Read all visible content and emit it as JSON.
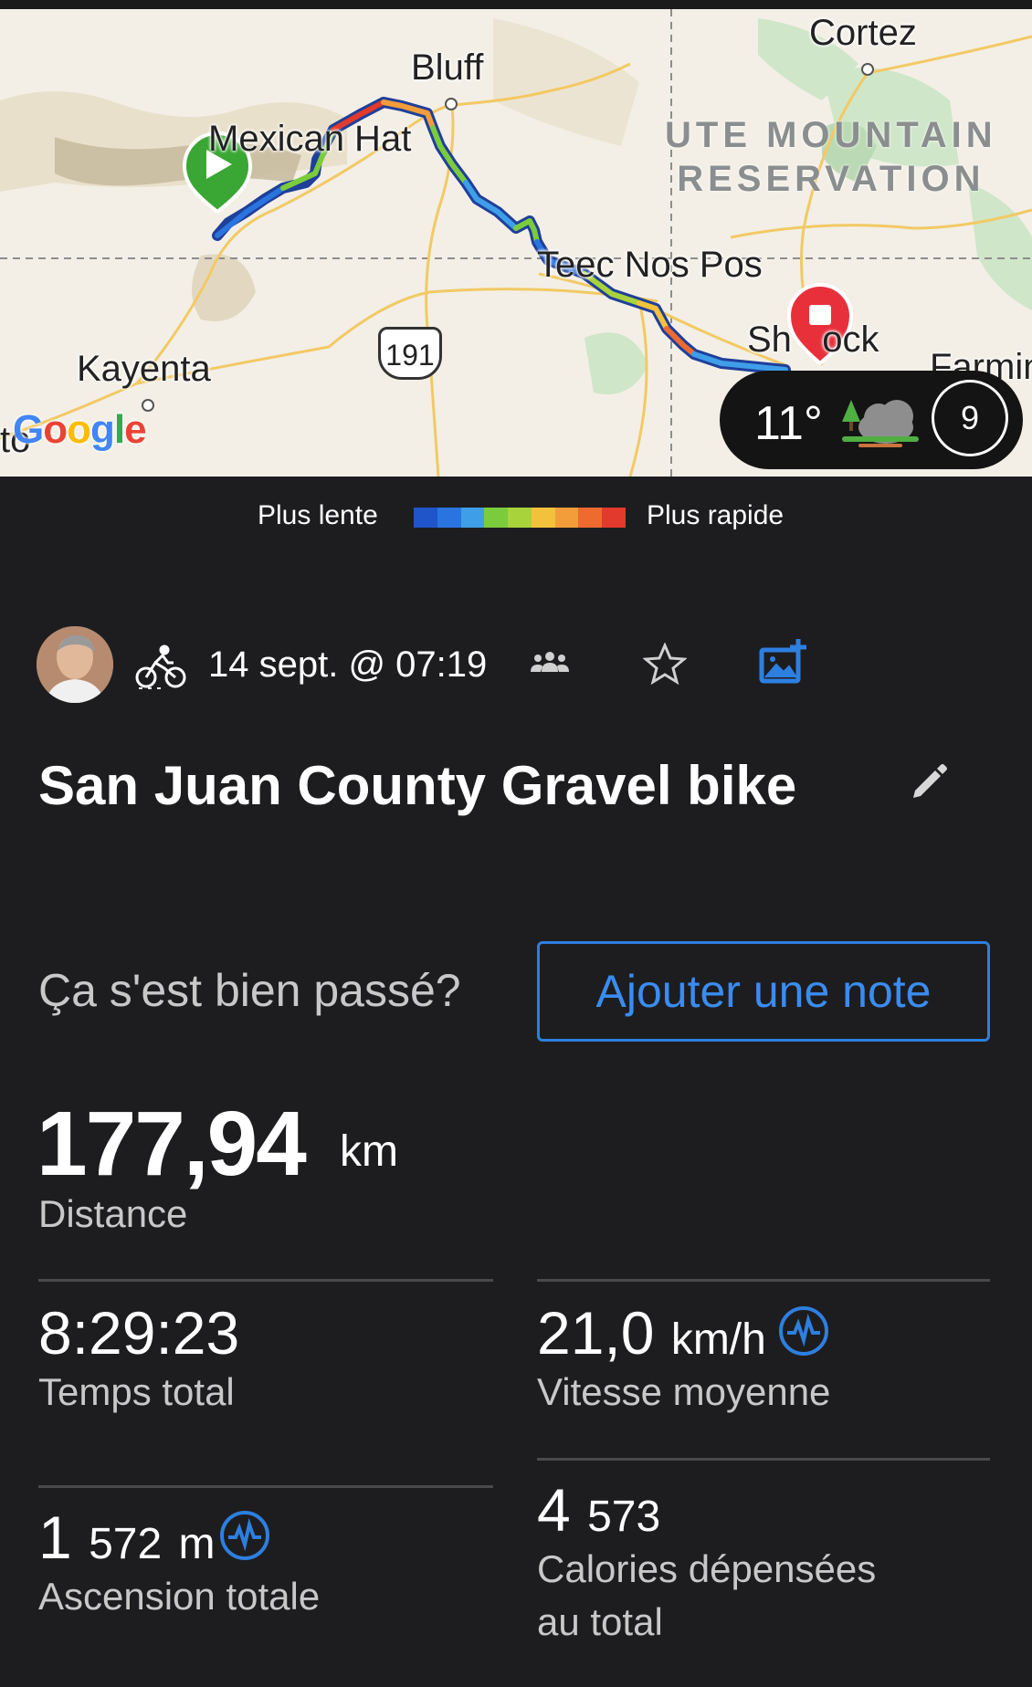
{
  "map": {
    "places": {
      "cortez": "Cortez",
      "bluff": "Bluff",
      "mexican_hat": "Mexican Hat",
      "teec_nos_pos": "Teec Nos Pos",
      "shiprock": "Sh   ock",
      "kayenta": "Kayenta",
      "farmington": "Farmin",
      "to": "to"
    },
    "reservation": "UTE MOUNTAIN\nRESERVATION",
    "highway": "191",
    "google": {
      "letters": [
        "G",
        "o",
        "o",
        "g",
        "l",
        "e"
      ],
      "colors": [
        "#4285F4",
        "#EA4335",
        "#FBBC05",
        "#4285F4",
        "#34A853",
        "#EA4335"
      ]
    },
    "start_marker": "play-icon",
    "end_marker": "stop-icon"
  },
  "weather": {
    "temperature": "11°",
    "condition_icon": "cloud-tree-icon",
    "index": "9"
  },
  "legend": {
    "slow_label": "Plus lente",
    "fast_label": "Plus rapide",
    "colors": [
      "#1f55c8",
      "#2a74e0",
      "#3f9ee8",
      "#7bcc3c",
      "#a8d33a",
      "#f2c23c",
      "#f29d3a",
      "#ef6a2e",
      "#e23a2c"
    ]
  },
  "activity": {
    "date": "14 sept. @ 07:19",
    "title": "San Juan County Gravel bike",
    "prompt": "Ça s'est bien passé?",
    "note_button": "Ajouter une note",
    "distance": {
      "value": "177,94",
      "unit": "km",
      "label": "Distance"
    },
    "total_time": {
      "value": "8:29:23",
      "label": "Temps total"
    },
    "avg_speed": {
      "value": "21,0",
      "unit": "km/h",
      "label": "Vitesse moyenne"
    },
    "ascent": {
      "value": "1",
      "value2": "572",
      "unit": "m",
      "label": "Ascension totale"
    },
    "calories": {
      "value": "4",
      "value2": "573",
      "label": "Calories dépensées au total"
    }
  },
  "colors": {
    "accent": "#2d7fe0",
    "background": "#1d1d1f"
  }
}
